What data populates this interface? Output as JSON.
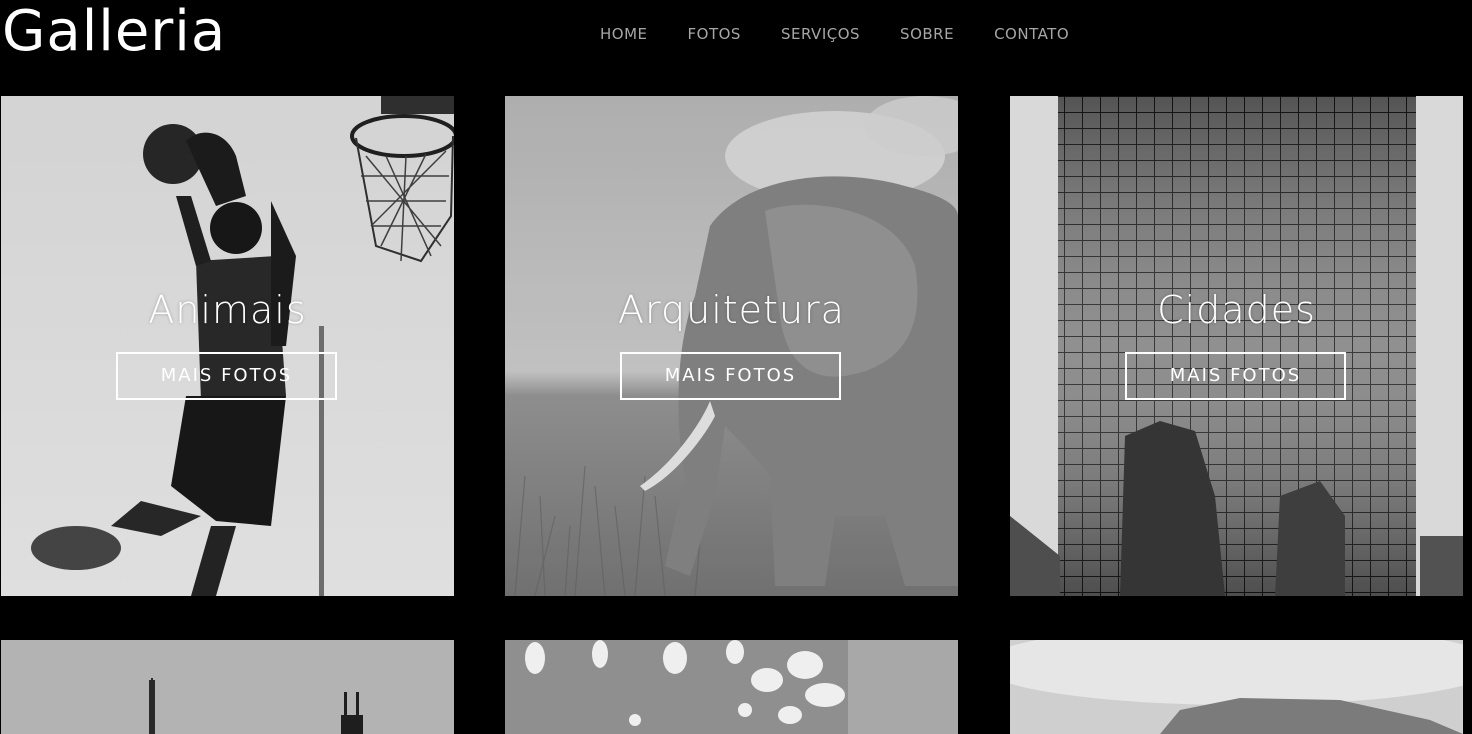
{
  "brand": {
    "logo": "Galleria"
  },
  "nav": {
    "items": [
      "HOME",
      "FOTOS",
      "SERVIÇOS",
      "SOBRE",
      "CONTATO"
    ]
  },
  "gallery": {
    "cards": [
      {
        "title": "Animais",
        "button": "MAIS FOTOS",
        "image": "basketball-player-photo"
      },
      {
        "title": "Arquitetura",
        "button": "MAIS FOTOS",
        "image": "elephant-photo"
      },
      {
        "title": "Cidades",
        "button": "MAIS FOTOS",
        "image": "skyscraper-photo"
      },
      {
        "title": "",
        "button": "",
        "image": "city-skyline-photo"
      },
      {
        "title": "",
        "button": "",
        "image": "bokeh-lights-photo"
      },
      {
        "title": "",
        "button": "",
        "image": "mountain-fog-photo"
      }
    ]
  },
  "colors": {
    "background": "#000000",
    "nav_text": "#a6a6a6",
    "text": "#ffffff"
  }
}
